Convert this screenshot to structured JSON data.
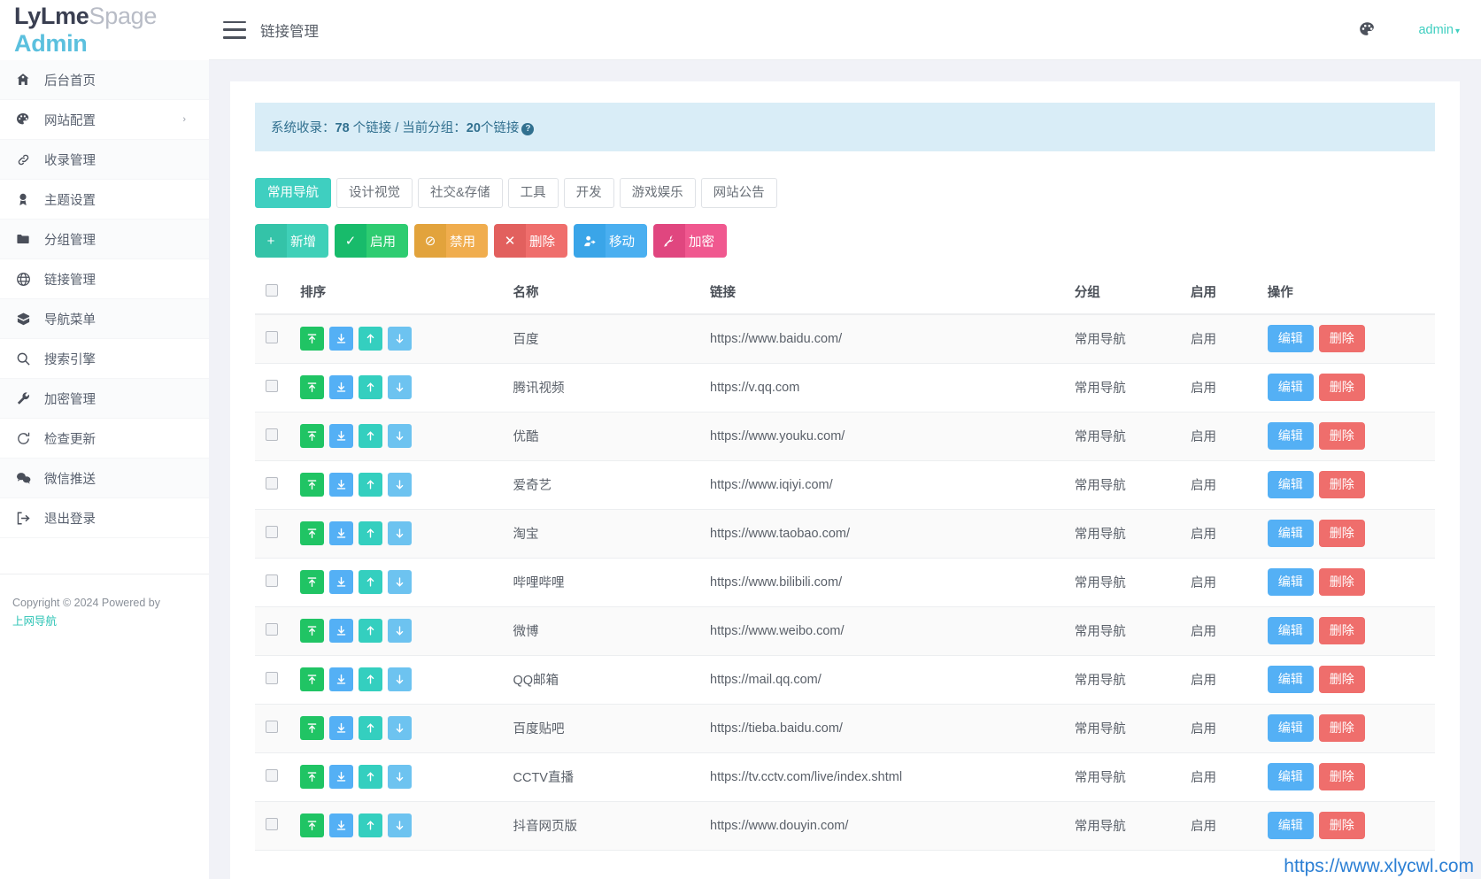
{
  "brand": {
    "part1": "LyLme",
    "part2": "Spage",
    "part3": "Admin"
  },
  "topbar": {
    "menu_icon": "hamburger-icon",
    "title": "链接管理",
    "palette_icon": "palette-icon",
    "admin_label": "admin",
    "admin_caret": "▾"
  },
  "sidebar": {
    "items": [
      {
        "label": "后台首页",
        "icon": "home-icon",
        "caret": ""
      },
      {
        "label": "网站配置",
        "icon": "palette-icon",
        "caret": "›"
      },
      {
        "label": "收录管理",
        "icon": "link-icon",
        "caret": ""
      },
      {
        "label": "主题设置",
        "icon": "award-icon",
        "caret": ""
      },
      {
        "label": "分组管理",
        "icon": "folder-icon",
        "caret": ""
      },
      {
        "label": "链接管理",
        "icon": "globe-icon",
        "caret": ""
      },
      {
        "label": "导航菜单",
        "icon": "box-icon",
        "caret": ""
      },
      {
        "label": "搜索引擎",
        "icon": "search-icon",
        "caret": ""
      },
      {
        "label": "加密管理",
        "icon": "wrench-icon",
        "caret": ""
      },
      {
        "label": "检查更新",
        "icon": "refresh-icon",
        "caret": ""
      },
      {
        "label": "微信推送",
        "icon": "wechat-icon",
        "caret": ""
      },
      {
        "label": "退出登录",
        "icon": "logout-icon",
        "caret": ""
      }
    ],
    "footer": {
      "copyright": "Copyright © 2024 Powered by",
      "link": "上网导航"
    }
  },
  "alert": {
    "label_total": "系统收录：",
    "total_count": "78",
    "total_unit": " 个链接 / ",
    "label_current": "当前分组：",
    "current_count": "20",
    "current_unit": "个链接",
    "help_icon": "?"
  },
  "tabs": [
    {
      "label": "常用导航",
      "active": true
    },
    {
      "label": "设计视觉",
      "active": false
    },
    {
      "label": "社交&存储",
      "active": false
    },
    {
      "label": "工具",
      "active": false
    },
    {
      "label": "开发",
      "active": false
    },
    {
      "label": "游戏娱乐",
      "active": false
    },
    {
      "label": "网站公告",
      "active": false
    }
  ],
  "toolbar": [
    {
      "label": "新增",
      "icon": "plus-icon",
      "glyph": "+"
    },
    {
      "label": "启用",
      "icon": "check-icon",
      "glyph": "✓"
    },
    {
      "label": "禁用",
      "icon": "ban-icon",
      "glyph": "⊘"
    },
    {
      "label": "删除",
      "icon": "times-icon",
      "glyph": "✕"
    },
    {
      "label": "移动",
      "icon": "user-move-icon",
      "glyph": ""
    },
    {
      "label": "加密",
      "icon": "key-icon",
      "glyph": ""
    }
  ],
  "table": {
    "headers": [
      "",
      "排序",
      "名称",
      "链接",
      "分组",
      "启用",
      "操作"
    ],
    "sort_buttons": [
      {
        "name": "move-to-top",
        "glyph": "top"
      },
      {
        "name": "move-to-bottom",
        "glyph": "bottom"
      },
      {
        "name": "move-up",
        "glyph": "up"
      },
      {
        "name": "move-down",
        "glyph": "down"
      }
    ],
    "op_edit": "编辑",
    "op_delete": "删除",
    "rows": [
      {
        "name": "百度",
        "link": "https://www.baidu.com/",
        "group": "常用导航",
        "status": "启用"
      },
      {
        "name": "腾讯视频",
        "link": "https://v.qq.com",
        "group": "常用导航",
        "status": "启用"
      },
      {
        "name": "优酷",
        "link": "https://www.youku.com/",
        "group": "常用导航",
        "status": "启用"
      },
      {
        "name": "爱奇艺",
        "link": "https://www.iqiyi.com/",
        "group": "常用导航",
        "status": "启用"
      },
      {
        "name": "淘宝",
        "link": "https://www.taobao.com/",
        "group": "常用导航",
        "status": "启用"
      },
      {
        "name": "哔哩哔哩",
        "link": "https://www.bilibili.com/",
        "group": "常用导航",
        "status": "启用"
      },
      {
        "name": "微博",
        "link": "https://www.weibo.com/",
        "group": "常用导航",
        "status": "启用"
      },
      {
        "name": "QQ邮箱",
        "link": "https://mail.qq.com/",
        "group": "常用导航",
        "status": "启用"
      },
      {
        "name": "百度贴吧",
        "link": "https://tieba.baidu.com/",
        "group": "常用导航",
        "status": "启用"
      },
      {
        "name": "CCTV直播",
        "link": "https://tv.cctv.com/live/index.shtml",
        "group": "常用导航",
        "status": "启用"
      },
      {
        "name": "抖音网页版",
        "link": "https://www.douyin.com/",
        "group": "常用导航",
        "status": "启用"
      }
    ]
  },
  "watermark": "https://www.xlycwl.com",
  "colors": {
    "accent": "#2ec4b6",
    "info_bg": "#d9edf7",
    "info_text": "#31708f",
    "edit": "#54b0f5",
    "delete": "#ef6e6c",
    "status_on": "#2fae54",
    "watermark": "#2b7fd4"
  }
}
